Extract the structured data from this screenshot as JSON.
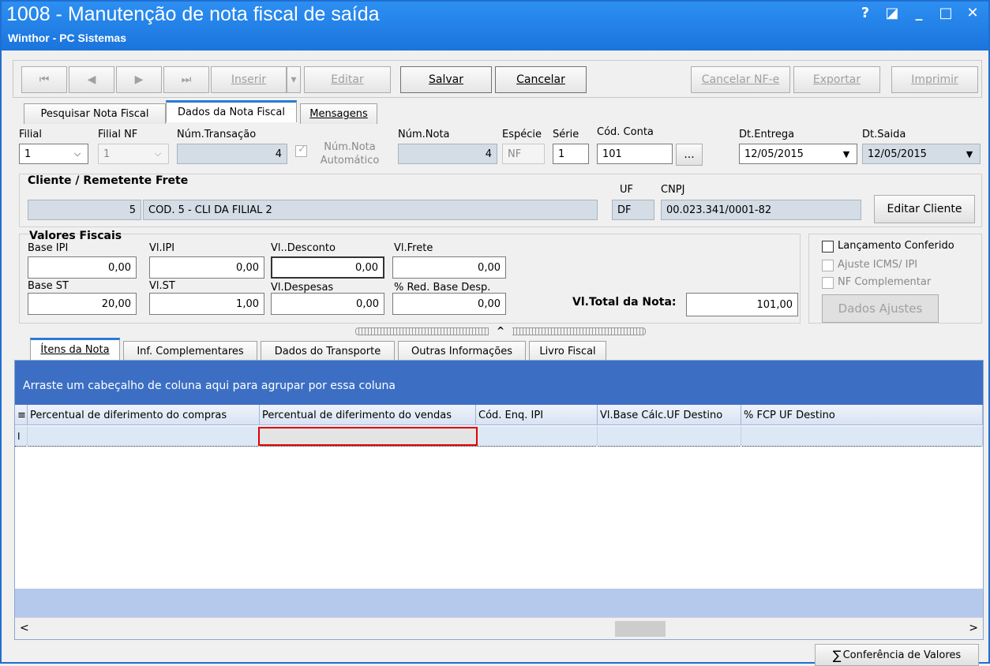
{
  "window": {
    "title": "1008 - Manutenção de nota fiscal de saída",
    "subtitle": "Winthor - PC Sistemas",
    "help": "?",
    "restore": "◪",
    "minimize": "_",
    "maximize": "□",
    "close": "✕"
  },
  "toolbar": {
    "first": "⏮",
    "prev": "◀",
    "next": "▶",
    "last": "⏭",
    "inserir": "Inserir",
    "inserir_arrow": "▾",
    "editar": "Editar",
    "salvar": "Salvar",
    "cancelar": "Cancelar",
    "cancelar_nfe": "Cancelar NF-e",
    "exportar": "Exportar",
    "imprimir": "Imprimir"
  },
  "tabs": [
    "Pesquisar Nota Fiscal",
    "Dados da Nota Fiscal",
    "Mensagens"
  ],
  "form": {
    "filial_label": "Filial",
    "filial_value": "1",
    "filial_nf_label": "Filial NF",
    "filial_nf_value": "1",
    "num_transacao_label": "Núm.Transação",
    "num_transacao_value": "4",
    "num_nota_auto_label": "Núm.Nota Automático",
    "num_nota_label": "Núm.Nota",
    "num_nota_value": "4",
    "especie_label": "Espécie",
    "especie_value": "NF",
    "serie_label": "Série",
    "serie_value": "1",
    "cod_conta_label": "Cód. Conta",
    "cod_conta_value": "101",
    "cod_conta_button": "...",
    "dt_entrega_label": "Dt.Entrega",
    "dt_entrega_value": "12/05/2015",
    "dt_saida_label": "Dt.Saida",
    "dt_saida_value": "12/05/2015",
    "dropdown_arrow": "▼",
    "combo_arrow": "⌵"
  },
  "cliente": {
    "section_title": "Cliente / Remetente Frete",
    "codigo": "5",
    "nome": "COD. 5 - CLI DA FILIAL 2",
    "uf_label": "UF",
    "uf_value": "DF",
    "cnpj_label": "CNPJ",
    "cnpj_value": "00.023.341/0001-82",
    "edit_button": "Editar Cliente"
  },
  "valores": {
    "section_title": "Valores Fiscais",
    "base_ipi_label": "Base IPI",
    "base_ipi_value": "0,00",
    "vl_ipi_label": "Vl.IPI",
    "vl_ipi_value": "0,00",
    "vl_desconto_label": "Vl..Desconto",
    "vl_desconto_value": "0,00",
    "vl_frete_label": "Vl.Frete",
    "vl_frete_value": "0,00",
    "base_st_label": "Base ST",
    "base_st_value": "20,00",
    "vl_st_label": "Vl.ST",
    "vl_st_value": "1,00",
    "vl_despesas_label": "Vl.Despesas",
    "vl_despesas_value": "0,00",
    "red_base_label": "% Red. Base Desp.",
    "red_base_value": "0,00",
    "vl_total_label": "Vl.Total da Nota:",
    "vl_total_value": "101,00"
  },
  "options": {
    "lancamento": "Lançamento Conferido",
    "ajuste": "Ajuste ICMS/ IPI",
    "nf_complementar": "NF Complementar",
    "dados_ajustes": "Dados Ajustes"
  },
  "splitter": "^",
  "subtabs": [
    "Ítens da Nota",
    "Inf. Complementares",
    "Dados do Transporte",
    "Outras Informações",
    "Livro Fiscal"
  ],
  "grid": {
    "group_hint": "Arraste um cabeçalho de coluna aqui para agrupar por essa coluna",
    "row_indicator": "I",
    "scroll_left": "<",
    "scroll_right": ">",
    "columns": [
      "Percentual de diferimento do compras",
      "Percentual de diferimento do vendas",
      "Cód. Enq. IPI",
      "Vl.Base Cálc.UF Destino",
      "% FCP UF Destino"
    ]
  },
  "footer": {
    "sigma": "∑",
    "conferencia": "Conferência de Valores"
  }
}
